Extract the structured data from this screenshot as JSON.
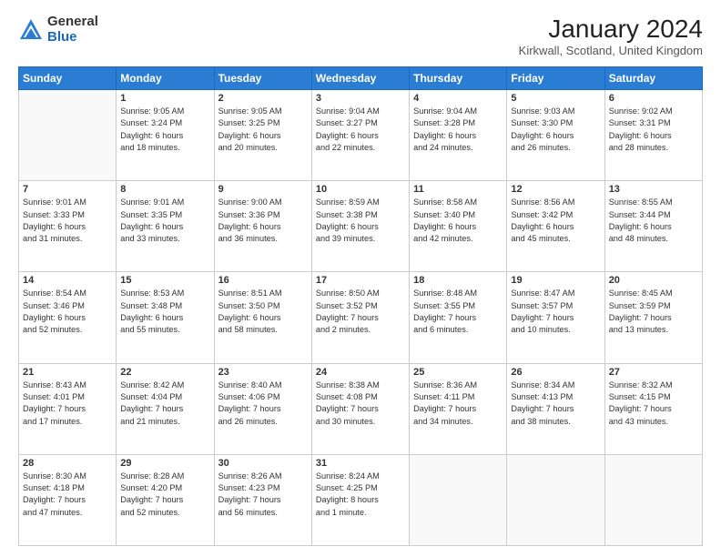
{
  "logo": {
    "general": "General",
    "blue": "Blue"
  },
  "title": {
    "month": "January 2024",
    "location": "Kirkwall, Scotland, United Kingdom"
  },
  "weekdays": [
    "Sunday",
    "Monday",
    "Tuesday",
    "Wednesday",
    "Thursday",
    "Friday",
    "Saturday"
  ],
  "weeks": [
    [
      {
        "day": "",
        "info": ""
      },
      {
        "day": "1",
        "info": "Sunrise: 9:05 AM\nSunset: 3:24 PM\nDaylight: 6 hours\nand 18 minutes."
      },
      {
        "day": "2",
        "info": "Sunrise: 9:05 AM\nSunset: 3:25 PM\nDaylight: 6 hours\nand 20 minutes."
      },
      {
        "day": "3",
        "info": "Sunrise: 9:04 AM\nSunset: 3:27 PM\nDaylight: 6 hours\nand 22 minutes."
      },
      {
        "day": "4",
        "info": "Sunrise: 9:04 AM\nSunset: 3:28 PM\nDaylight: 6 hours\nand 24 minutes."
      },
      {
        "day": "5",
        "info": "Sunrise: 9:03 AM\nSunset: 3:30 PM\nDaylight: 6 hours\nand 26 minutes."
      },
      {
        "day": "6",
        "info": "Sunrise: 9:02 AM\nSunset: 3:31 PM\nDaylight: 6 hours\nand 28 minutes."
      }
    ],
    [
      {
        "day": "7",
        "info": "Sunrise: 9:01 AM\nSunset: 3:33 PM\nDaylight: 6 hours\nand 31 minutes."
      },
      {
        "day": "8",
        "info": "Sunrise: 9:01 AM\nSunset: 3:35 PM\nDaylight: 6 hours\nand 33 minutes."
      },
      {
        "day": "9",
        "info": "Sunrise: 9:00 AM\nSunset: 3:36 PM\nDaylight: 6 hours\nand 36 minutes."
      },
      {
        "day": "10",
        "info": "Sunrise: 8:59 AM\nSunset: 3:38 PM\nDaylight: 6 hours\nand 39 minutes."
      },
      {
        "day": "11",
        "info": "Sunrise: 8:58 AM\nSunset: 3:40 PM\nDaylight: 6 hours\nand 42 minutes."
      },
      {
        "day": "12",
        "info": "Sunrise: 8:56 AM\nSunset: 3:42 PM\nDaylight: 6 hours\nand 45 minutes."
      },
      {
        "day": "13",
        "info": "Sunrise: 8:55 AM\nSunset: 3:44 PM\nDaylight: 6 hours\nand 48 minutes."
      }
    ],
    [
      {
        "day": "14",
        "info": "Sunrise: 8:54 AM\nSunset: 3:46 PM\nDaylight: 6 hours\nand 52 minutes."
      },
      {
        "day": "15",
        "info": "Sunrise: 8:53 AM\nSunset: 3:48 PM\nDaylight: 6 hours\nand 55 minutes."
      },
      {
        "day": "16",
        "info": "Sunrise: 8:51 AM\nSunset: 3:50 PM\nDaylight: 6 hours\nand 58 minutes."
      },
      {
        "day": "17",
        "info": "Sunrise: 8:50 AM\nSunset: 3:52 PM\nDaylight: 7 hours\nand 2 minutes."
      },
      {
        "day": "18",
        "info": "Sunrise: 8:48 AM\nSunset: 3:55 PM\nDaylight: 7 hours\nand 6 minutes."
      },
      {
        "day": "19",
        "info": "Sunrise: 8:47 AM\nSunset: 3:57 PM\nDaylight: 7 hours\nand 10 minutes."
      },
      {
        "day": "20",
        "info": "Sunrise: 8:45 AM\nSunset: 3:59 PM\nDaylight: 7 hours\nand 13 minutes."
      }
    ],
    [
      {
        "day": "21",
        "info": "Sunrise: 8:43 AM\nSunset: 4:01 PM\nDaylight: 7 hours\nand 17 minutes."
      },
      {
        "day": "22",
        "info": "Sunrise: 8:42 AM\nSunset: 4:04 PM\nDaylight: 7 hours\nand 21 minutes."
      },
      {
        "day": "23",
        "info": "Sunrise: 8:40 AM\nSunset: 4:06 PM\nDaylight: 7 hours\nand 26 minutes."
      },
      {
        "day": "24",
        "info": "Sunrise: 8:38 AM\nSunset: 4:08 PM\nDaylight: 7 hours\nand 30 minutes."
      },
      {
        "day": "25",
        "info": "Sunrise: 8:36 AM\nSunset: 4:11 PM\nDaylight: 7 hours\nand 34 minutes."
      },
      {
        "day": "26",
        "info": "Sunrise: 8:34 AM\nSunset: 4:13 PM\nDaylight: 7 hours\nand 38 minutes."
      },
      {
        "day": "27",
        "info": "Sunrise: 8:32 AM\nSunset: 4:15 PM\nDaylight: 7 hours\nand 43 minutes."
      }
    ],
    [
      {
        "day": "28",
        "info": "Sunrise: 8:30 AM\nSunset: 4:18 PM\nDaylight: 7 hours\nand 47 minutes."
      },
      {
        "day": "29",
        "info": "Sunrise: 8:28 AM\nSunset: 4:20 PM\nDaylight: 7 hours\nand 52 minutes."
      },
      {
        "day": "30",
        "info": "Sunrise: 8:26 AM\nSunset: 4:23 PM\nDaylight: 7 hours\nand 56 minutes."
      },
      {
        "day": "31",
        "info": "Sunrise: 8:24 AM\nSunset: 4:25 PM\nDaylight: 8 hours\nand 1 minute."
      },
      {
        "day": "",
        "info": ""
      },
      {
        "day": "",
        "info": ""
      },
      {
        "day": "",
        "info": ""
      }
    ]
  ]
}
